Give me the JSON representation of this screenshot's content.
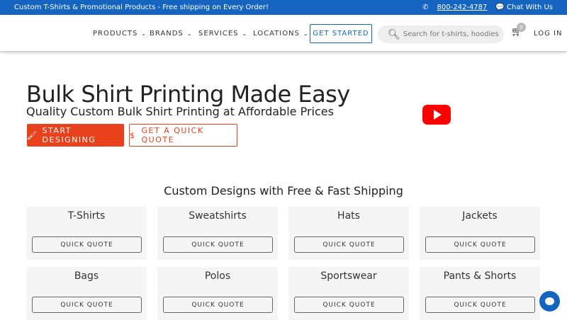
{
  "topbar": {
    "promo": "Custom T-Shirts & Promotional Products - Free shipping on Every Order!",
    "phone": "800-242-4787",
    "chat": "Chat With Us"
  },
  "nav": {
    "items": [
      "PRODUCTS",
      "BRANDS",
      "SERVICES",
      "LOCATIONS"
    ],
    "get_started": "GET STARTED",
    "search_placeholder": "Search for t-shirts, hoodies, bags",
    "cart_count": "0",
    "login": "LOG IN"
  },
  "hero": {
    "title": "Bulk Shirt Printing Made Easy",
    "subtitle": "Quality Custom Bulk Shirt Printing at Affordable Prices",
    "start_designing": "START DESIGNING",
    "quick_quote": "GET A QUICK QUOTE"
  },
  "section_title": "Custom Designs with Free & Fast Shipping",
  "categories": [
    {
      "name": "T-Shirts",
      "button": "QUICK QUOTE"
    },
    {
      "name": "Sweatshirts",
      "button": "QUICK QUOTE"
    },
    {
      "name": "Hats",
      "button": "QUICK QUOTE"
    },
    {
      "name": "Jackets",
      "button": "QUICK QUOTE"
    },
    {
      "name": "Bags",
      "button": "QUICK QUOTE"
    },
    {
      "name": "Polos",
      "button": "QUICK QUOTE"
    },
    {
      "name": "Sportswear",
      "button": "QUICK QUOTE"
    },
    {
      "name": "Pants & Shorts",
      "button": "QUICK QUOTE"
    }
  ],
  "colors": {
    "brand": "#1565c0",
    "accent": "#e8411c"
  }
}
